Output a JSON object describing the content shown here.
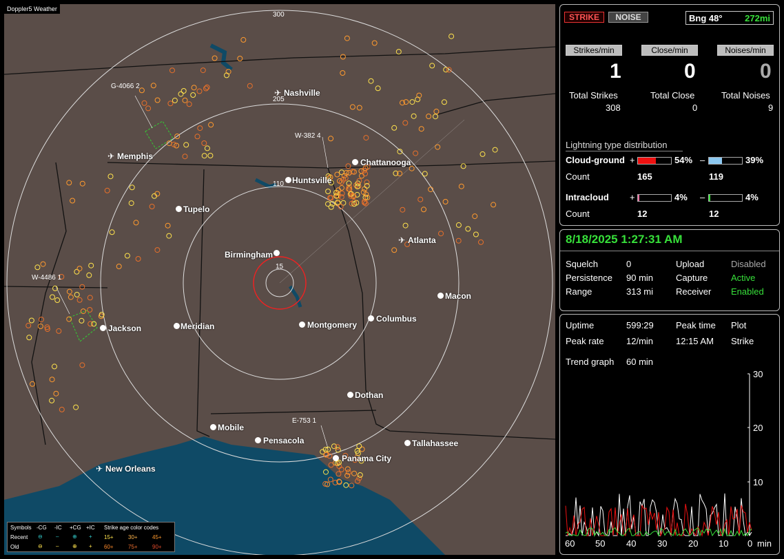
{
  "app": {
    "title": "Doppler5 Weather"
  },
  "colors": {
    "map_land": "#5a4d48",
    "map_water": "#0f4a66",
    "recent": "#ffe34d",
    "mid": "#ff9a2e",
    "old": "#e8702a",
    "accent_green": "#37e03a"
  },
  "map": {
    "ring_labels": [
      "300",
      "205",
      "110",
      "15"
    ],
    "cities": [
      "Nashville",
      "Memphis",
      "Chattanooga",
      "Huntsville",
      "Tupelo",
      "Atlanta",
      "Birmingham",
      "Macon",
      "Jackson",
      "Meridian",
      "Montgomery",
      "Columbus",
      "Dothan",
      "Mobile",
      "Pensacola",
      "Tallahassee",
      "Panama City",
      "New Orleans"
    ],
    "warnings": [
      "G-4066 2",
      "W-382 4",
      "W-4486 1",
      "E-753 1"
    ]
  },
  "legend": {
    "symbols_label": "Symbols",
    "cols": [
      "-CG",
      "-IC",
      "+CG",
      "+IC"
    ],
    "recent_label": "Recent",
    "old_label": "Old",
    "age_title": "Strike age color codes",
    "ages_row1": [
      "15+",
      "30+",
      "45+"
    ],
    "ages_row2": [
      "60+",
      "75+",
      "90+"
    ]
  },
  "status": {
    "strike_label": "STRIKE",
    "noise_label": "NOISE",
    "bearing": "Bng 48°",
    "distance": "272mi",
    "strikes_per_min_label": "Strikes/min",
    "close_per_min_label": "Close/min",
    "noises_per_min_label": "Noises/min",
    "strikes_per_min": "1",
    "close_per_min": "0",
    "noises_per_min": "0",
    "total_strikes_label": "Total Strikes",
    "total_close_label": "Total Close",
    "total_noises_label": "Total Noises",
    "total_strikes": "308",
    "total_close": "0",
    "total_noises": "9",
    "dist_title": "Lightning type distribution",
    "cg_label": "Cloud-ground",
    "ic_label": "Intracloud",
    "count_label": "Count",
    "plus": "+",
    "minus": "–",
    "cg_pos_pct": "54%",
    "cg_neg_pct": "39%",
    "cg_pos_count": "165",
    "cg_neg_count": "119",
    "ic_pos_pct": "4%",
    "ic_neg_pct": "4%",
    "ic_pos_count": "12",
    "ic_neg_count": "12",
    "cg_pos_frac": 0.54,
    "cg_neg_frac": 0.39,
    "ic_pos_frac": 0.04,
    "ic_neg_frac": 0.04
  },
  "settings": {
    "datetime": "8/18/2025 1:27:31 AM",
    "squelch_label": "Squelch",
    "squelch": "0",
    "persistence_label": "Persistence",
    "persistence": "90 min",
    "range_label": "Range",
    "range": "313 mi",
    "upload_label": "Upload",
    "upload": "Disabled",
    "capture_label": "Capture",
    "capture": "Active",
    "receiver_label": "Receiver",
    "receiver": "Enabled"
  },
  "trend": {
    "uptime_label": "Uptime",
    "uptime": "599:29",
    "peak_time_label": "Peak time",
    "peak_time": "12:15 AM",
    "plot_label": "Plot",
    "plot": "Strike",
    "peak_rate_label": "Peak rate",
    "peak_rate": "12/min",
    "trend_label": "Trend graph",
    "trend_value": "60 min",
    "y_ticks": [
      "30",
      "20",
      "10"
    ],
    "x_ticks": [
      "60",
      "50",
      "40",
      "30",
      "20",
      "10",
      "0"
    ],
    "x_unit": "min"
  }
}
